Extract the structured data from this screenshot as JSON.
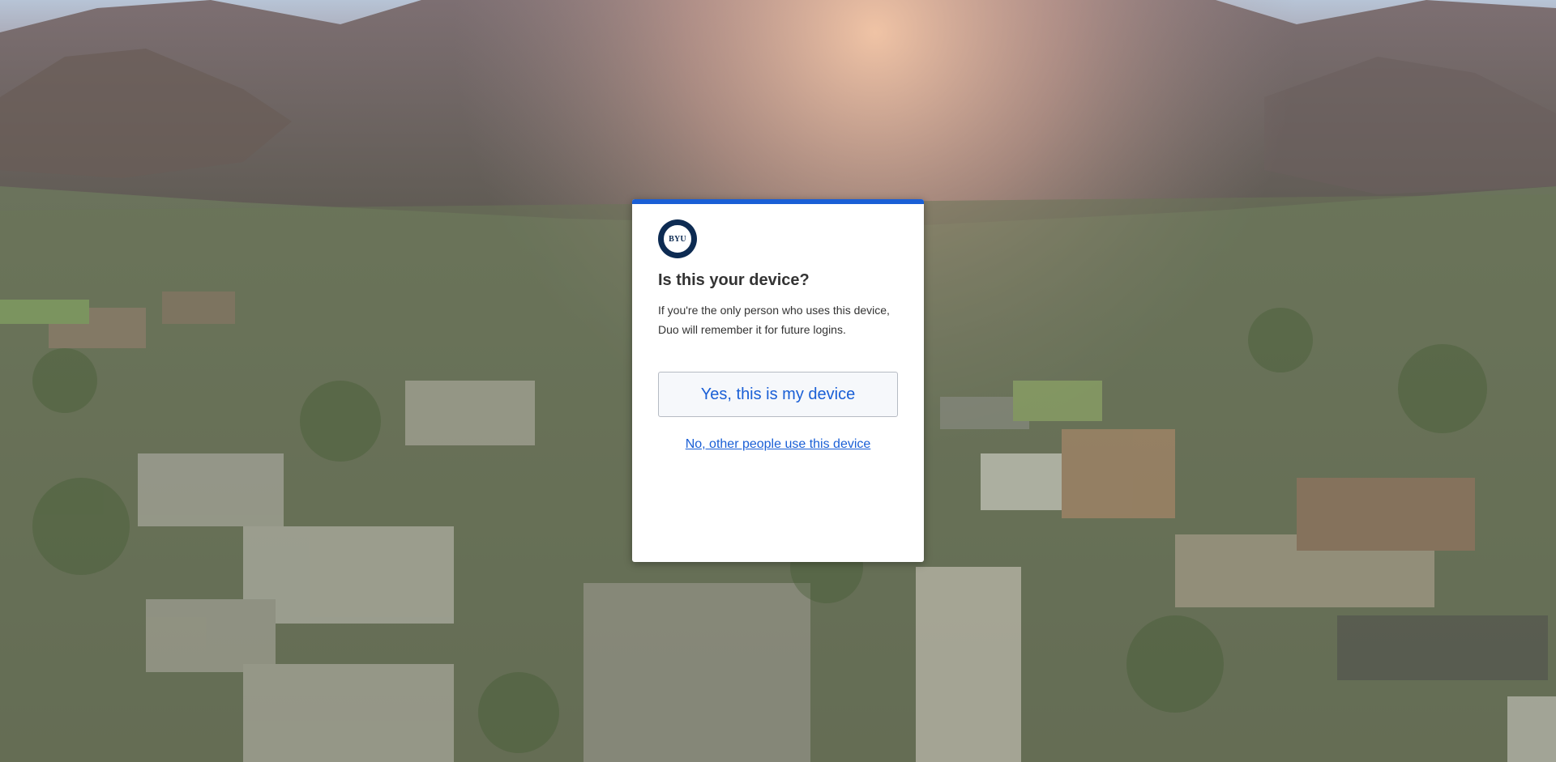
{
  "colors": {
    "accent": "#1a5fd6",
    "logo_navy": "#0d2b52",
    "text": "#333333",
    "button_bg": "#f6f8fb",
    "button_border": "#b6bbc3"
  },
  "background": {
    "icon": "campus-aerial-photo"
  },
  "prompt": {
    "logo_text": "BYU",
    "title": "Is this your device?",
    "description": "If you're the only person who uses this device, Duo will remember it for future logins.",
    "yes_button_label": "Yes, this is my device",
    "no_link_label": "No, other people use this device"
  }
}
